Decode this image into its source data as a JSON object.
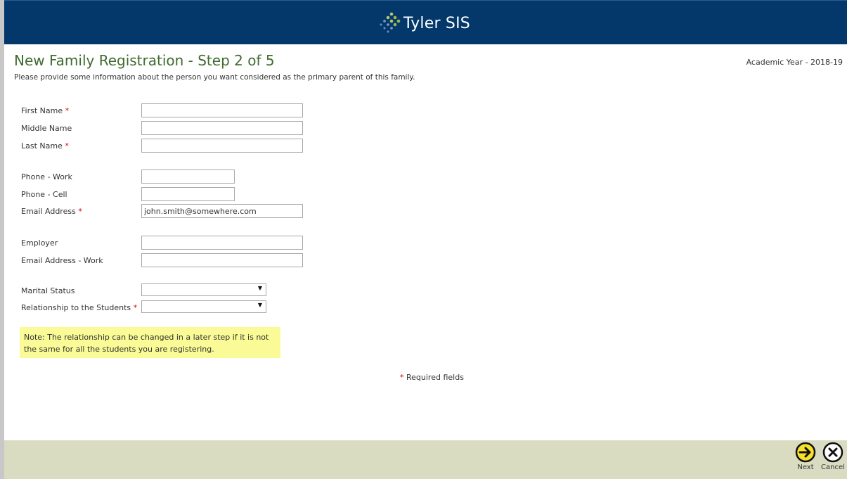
{
  "header": {
    "brand": "Tyler SIS"
  },
  "page": {
    "title": "New Family Registration - Step 2 of 5",
    "subtitle": "Please provide some information about the person you want considered as the primary parent of this family.",
    "academic_year": "Academic Year - 2018-19"
  },
  "form": {
    "first_name": {
      "label": "First Name",
      "value": ""
    },
    "middle_name": {
      "label": "Middle Name",
      "value": ""
    },
    "last_name": {
      "label": "Last Name",
      "value": ""
    },
    "phone_work": {
      "label": "Phone - Work",
      "value": ""
    },
    "phone_cell": {
      "label": "Phone - Cell",
      "value": ""
    },
    "email": {
      "label": "Email Address",
      "value": "john.smith@somewhere.com"
    },
    "employer": {
      "label": "Employer",
      "value": ""
    },
    "email_work": {
      "label": "Email Address - Work",
      "value": ""
    },
    "marital_status": {
      "label": "Marital Status",
      "value": ""
    },
    "relationship": {
      "label": "Relationship to the Students",
      "value": ""
    },
    "required_marker": "*"
  },
  "note": "Note: The relationship can be changed in a later step if it is not the same for all the students you are registering.",
  "required_fields": "Required fields",
  "footer": {
    "next_label": "Next",
    "cancel_label": "Cancel"
  },
  "colors": {
    "header_bg": "#04386b",
    "title_green": "#3f6b2e",
    "footer_bg": "#d9dcc0",
    "note_bg": "#fafa96",
    "required_red": "#d60000"
  },
  "icons": {
    "logo": "dots-logo-icon",
    "next": "arrow-right-circle-icon",
    "cancel": "x-circle-icon",
    "dropdown": "triangle-down-icon"
  }
}
